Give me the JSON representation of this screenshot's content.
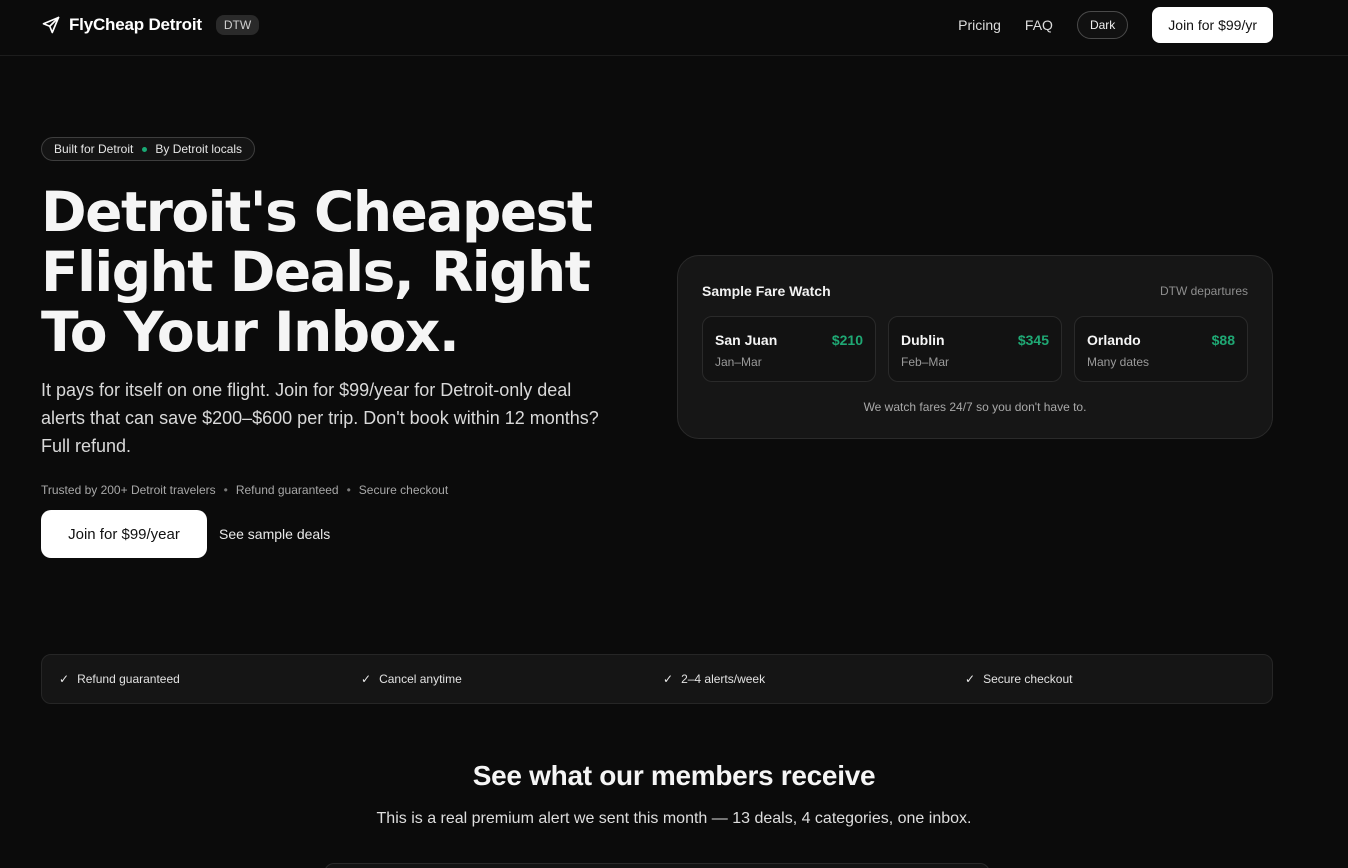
{
  "nav": {
    "brand": "FlyCheap Detroit",
    "airport_code": "DTW",
    "links": [
      "Pricing",
      "FAQ"
    ],
    "theme_toggle": "Dark",
    "join_button": "Join for $99/yr"
  },
  "hero": {
    "pill_left": "Built for Detroit",
    "pill_right": "By Detroit locals",
    "headline_lines": [
      "Detroit's Cheapest",
      "Flight Deals, Right",
      "To Your Inbox."
    ],
    "subtext_lines": [
      "It pays for itself on one flight. Join for $99/year for Detroit-only deal",
      "alerts that can save $200–$600 per trip. Don't book within 12 months?",
      "Full refund."
    ],
    "trust": [
      "Trusted by 200+ Detroit travelers",
      "Refund guaranteed",
      "Secure checkout"
    ],
    "primary_cta": "Join for $99/year",
    "secondary_cta": "See sample deals"
  },
  "fare_watch": {
    "title": "Sample Fare Watch",
    "tag": "DTW departures",
    "deals": [
      {
        "city": "San Juan",
        "price": "$210",
        "dates": "Jan–Mar"
      },
      {
        "city": "Dublin",
        "price": "$345",
        "dates": "Feb–Mar"
      },
      {
        "city": "Orlando",
        "price": "$88",
        "dates": "Many dates"
      }
    ],
    "note": "We watch fares 24/7 so you don't have to."
  },
  "features": [
    "Refund guaranteed",
    "Cancel anytime",
    "2–4 alerts/week",
    "Secure checkout"
  ],
  "section": {
    "title": "See what our members receive",
    "subtitle": "This is a real premium alert we sent this month — 13 deals, 4 categories, one inbox."
  },
  "colors": {
    "background": "#0b0b0b",
    "accent_green": "#1fa874",
    "card": "#161616"
  }
}
